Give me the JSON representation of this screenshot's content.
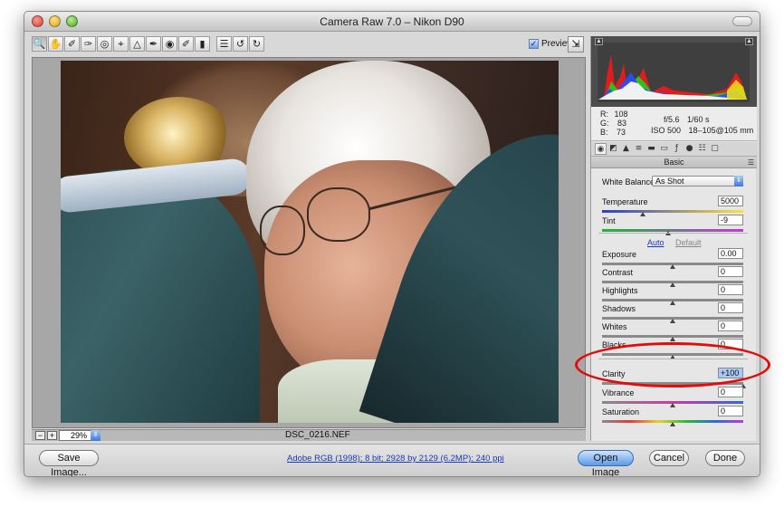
{
  "window": {
    "title": "Camera Raw 7.0  –  Nikon D90"
  },
  "toolbar": {
    "tools": [
      {
        "name": "zoom-tool-icon",
        "glyph": "🔍",
        "active": true
      },
      {
        "name": "hand-tool-icon",
        "glyph": "✋"
      },
      {
        "name": "white-balance-tool-icon",
        "glyph": "✐"
      },
      {
        "name": "color-sampler-tool-icon",
        "glyph": "✑"
      },
      {
        "name": "targeted-adjustment-tool-icon",
        "glyph": "◎"
      },
      {
        "name": "crop-tool-icon",
        "glyph": "⌖"
      },
      {
        "name": "straighten-tool-icon",
        "glyph": "△"
      },
      {
        "name": "spot-removal-tool-icon",
        "glyph": "✒"
      },
      {
        "name": "red-eye-tool-icon",
        "glyph": "◉"
      },
      {
        "name": "adjustment-brush-icon",
        "glyph": "✐"
      },
      {
        "name": "graduated-filter-icon",
        "glyph": "▮"
      },
      {
        "name": "preferences-icon",
        "glyph": "☰"
      },
      {
        "name": "rotate-left-icon",
        "glyph": "↺"
      },
      {
        "name": "rotate-right-icon",
        "glyph": "↻"
      }
    ],
    "preview_label": "Preview",
    "preview_checked": true
  },
  "status": {
    "zoom": "29%",
    "filename": "DSC_0216.NEF"
  },
  "readout": {
    "r_label": "R:",
    "r_value": "108",
    "g_label": "G:",
    "g_value": "83",
    "b_label": "B:",
    "b_value": "73",
    "aperture": "f/5.6",
    "shutter": "1/60 s",
    "iso": "ISO 500",
    "lens": "18–105@105 mm"
  },
  "panel": {
    "section_title": "Basic",
    "white_balance_label": "White Balance:",
    "white_balance_value": "As Shot",
    "auto_label": "Auto",
    "default_label": "Default",
    "sliders": [
      {
        "key": "temperature",
        "label": "Temperature",
        "value": "5000",
        "fraction": 0.29,
        "track": "temp"
      },
      {
        "key": "tint",
        "label": "Tint",
        "value": "-9",
        "fraction": 0.47,
        "track": "tint"
      },
      {
        "key": "exposure",
        "label": "Exposure",
        "value": "0.00",
        "fraction": 0.5,
        "track": "gray"
      },
      {
        "key": "contrast",
        "label": "Contrast",
        "value": "0",
        "fraction": 0.5,
        "track": "gray"
      },
      {
        "key": "highlights",
        "label": "Highlights",
        "value": "0",
        "fraction": 0.5,
        "track": "gray"
      },
      {
        "key": "shadows",
        "label": "Shadows",
        "value": "0",
        "fraction": 0.5,
        "track": "gray"
      },
      {
        "key": "whites",
        "label": "Whites",
        "value": "0",
        "fraction": 0.5,
        "track": "gray"
      },
      {
        "key": "blacks",
        "label": "Blacks",
        "value": "0",
        "fraction": 0.5,
        "track": "gray"
      },
      {
        "key": "clarity",
        "label": "Clarity",
        "value": "+100",
        "fraction": 1.0,
        "track": "gray"
      },
      {
        "key": "vibrance",
        "label": "Vibrance",
        "value": "0",
        "fraction": 0.5,
        "track": "vib"
      },
      {
        "key": "saturation",
        "label": "Saturation",
        "value": "0",
        "fraction": 0.5,
        "track": "sat"
      }
    ]
  },
  "bottom": {
    "save_label": "Save Image...",
    "workflow_label": "Adobe RGB (1998); 8 bit; 2928 by 2129 (6.2MP); 240 ppi",
    "open_label": "Open Image",
    "cancel_label": "Cancel",
    "done_label": "Done"
  },
  "colors": {
    "annotation": "#e00d0d",
    "primary_button": "#5a9ae8"
  }
}
